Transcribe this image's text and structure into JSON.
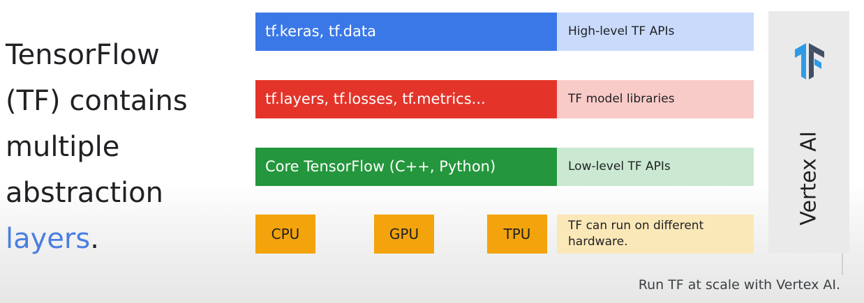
{
  "headline": {
    "line1": "TensorFlow",
    "line2": "(TF) contains",
    "line3": "multiple",
    "line4": "abstraction",
    "line5_accent": "layers",
    "line5_end": "."
  },
  "layers": [
    {
      "label": "tf.keras, tf.data",
      "description": "High-level TF APIs",
      "color": "#3b78e7",
      "desc_bg": "#c9dafb"
    },
    {
      "label": "tf.layers, tf.losses, tf.metrics...",
      "description": "TF model libraries",
      "color": "#e4342a",
      "desc_bg": "#f8cbc8"
    },
    {
      "label": "Core TensorFlow (C++, Python)",
      "description": "Low-level TF APIs",
      "color": "#24963d",
      "desc_bg": "#cbe9d2"
    }
  ],
  "hardware": {
    "items": [
      "CPU",
      "GPU",
      "TPU"
    ],
    "description_line1": "TF can run on different",
    "description_line2": "hardware.",
    "color": "#f3a30b"
  },
  "vertex": {
    "label": "Vertex AI",
    "logo_icon": "tensorflow-logo-icon",
    "logo_colors": [
      "#425066",
      "#2f9be8"
    ]
  },
  "caption": "Run TF at scale with Vertex AI."
}
